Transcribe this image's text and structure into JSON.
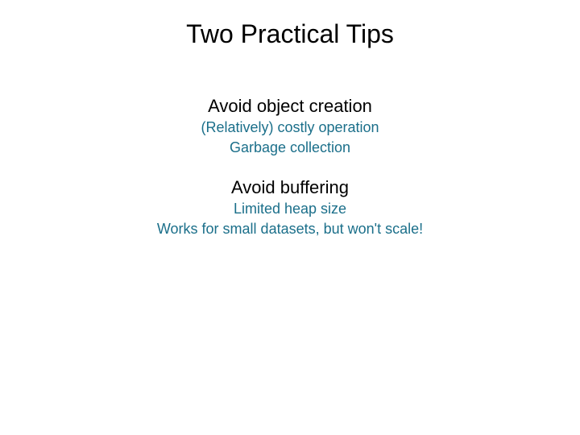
{
  "title": "Two Practical Tips",
  "sections": [
    {
      "heading": "Avoid object creation",
      "details": [
        "(Relatively) costly operation",
        "Garbage collection"
      ]
    },
    {
      "heading": "Avoid buffering",
      "details": [
        "Limited heap size",
        "Works for small datasets, but won't scale!"
      ]
    }
  ]
}
